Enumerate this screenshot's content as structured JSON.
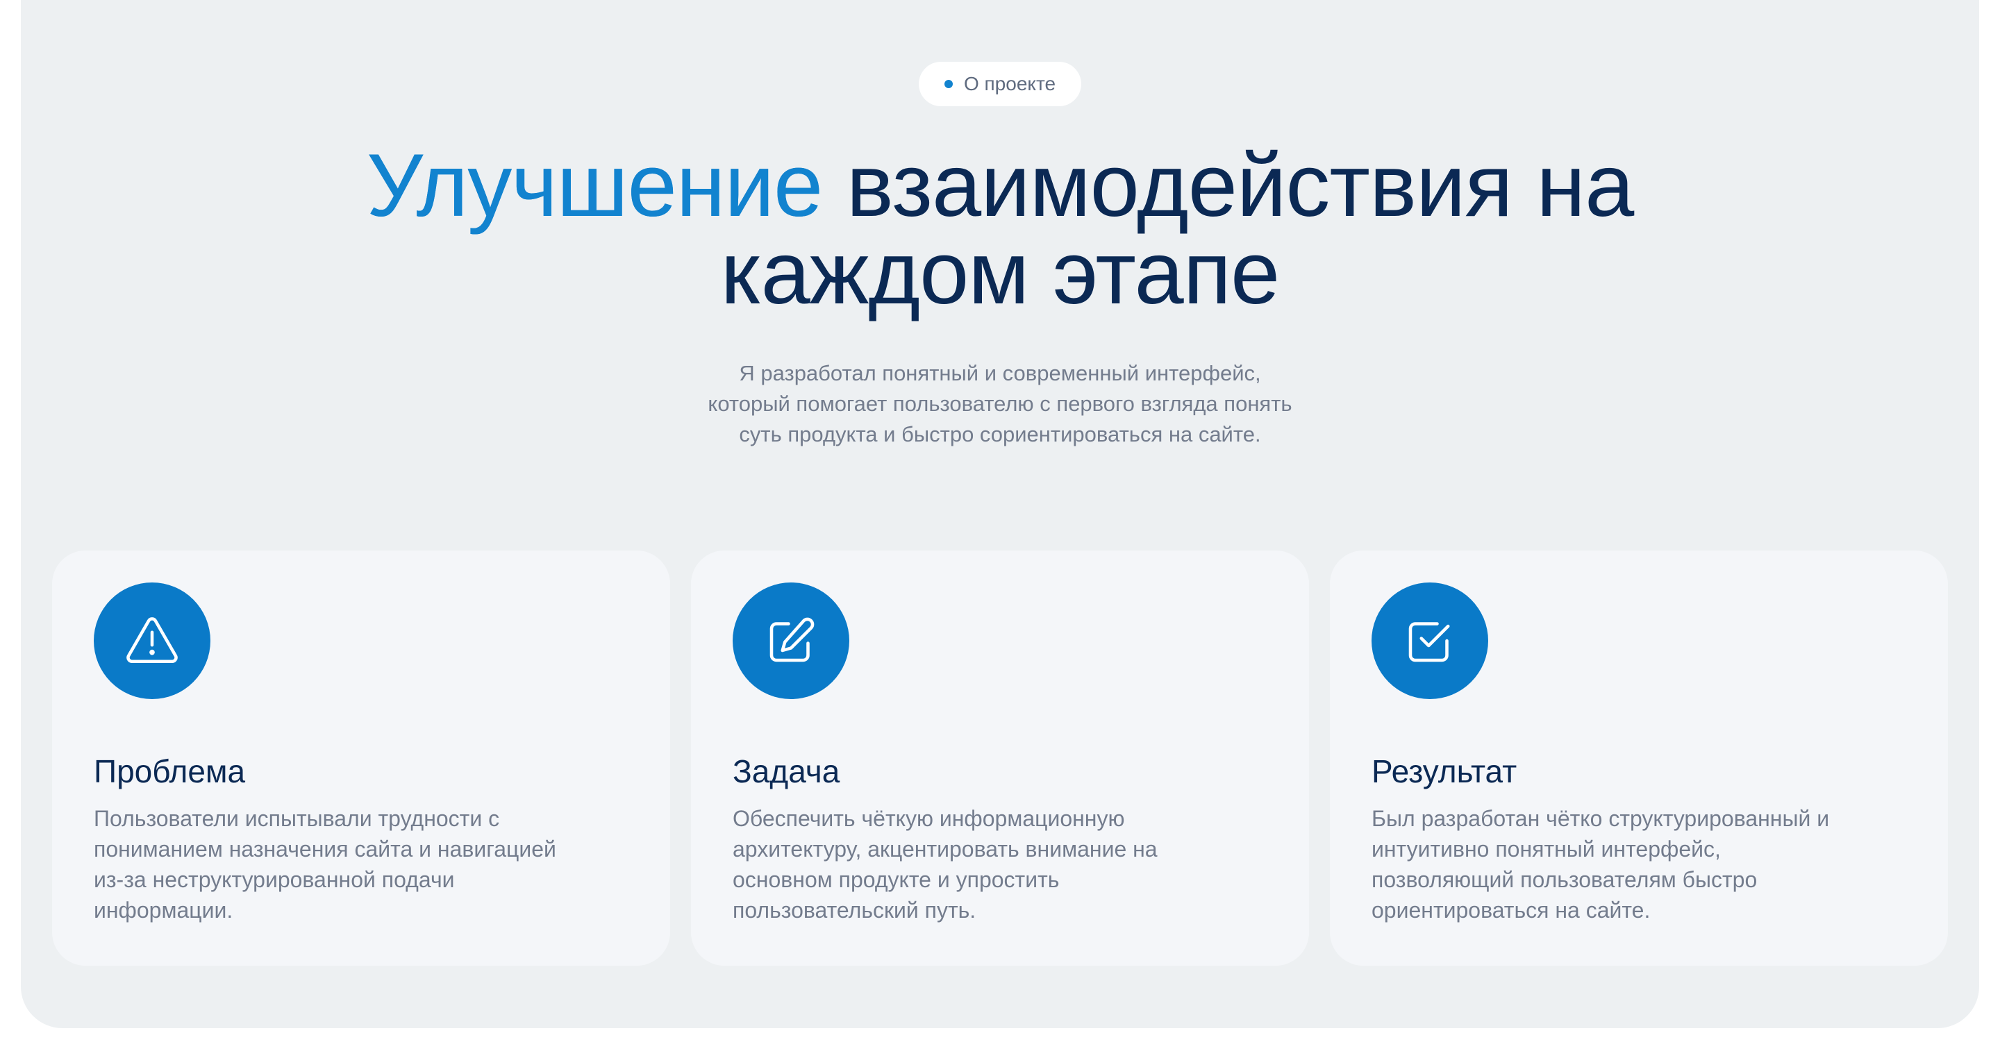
{
  "colors": {
    "section_bg": "#edf0f2",
    "card_bg": "#f4f6f9",
    "accent_blue": "#0a7ac8",
    "heading_navy": "#0b2954",
    "body_gray": "#737c8d"
  },
  "badge": {
    "label": "О проекте",
    "dot_color": "#1283cf"
  },
  "headline": {
    "accent": "Улучшение",
    "rest_line1": " взаимодействия на",
    "line2": "каждом этапе"
  },
  "subtitle": {
    "lines": [
      "Я разработал понятный и современный интерфейс,",
      "который помогает пользователю с первого взгляда понять",
      "суть продукта и быстро сориентироваться на сайте."
    ]
  },
  "cards": [
    {
      "icon": "warning-triangle-icon",
      "icon_bg": "#0a7ac8",
      "title": "Проблема",
      "lines": [
        "Пользователи испытывали трудности с",
        "пониманием назначения сайта и навигацией",
        "из-за неструктурированной подачи",
        "информации."
      ]
    },
    {
      "icon": "edit-pencil-icon",
      "icon_bg": "#0a7ac8",
      "title": "Задача",
      "lines": [
        "Обеспечить чёткую информационную",
        "архитектуру, акцентировать внимание на",
        "основном продукте и упростить",
        "пользовательский путь."
      ]
    },
    {
      "icon": "checkbox-checked-icon",
      "icon_bg": "#0a7ac8",
      "title": "Результат",
      "lines": [
        "Был разработан чётко структурированный и",
        "интуитивно понятный интерфейс,",
        "позволяющий пользователям быстро",
        "ориентироваться  на сайте."
      ]
    }
  ]
}
